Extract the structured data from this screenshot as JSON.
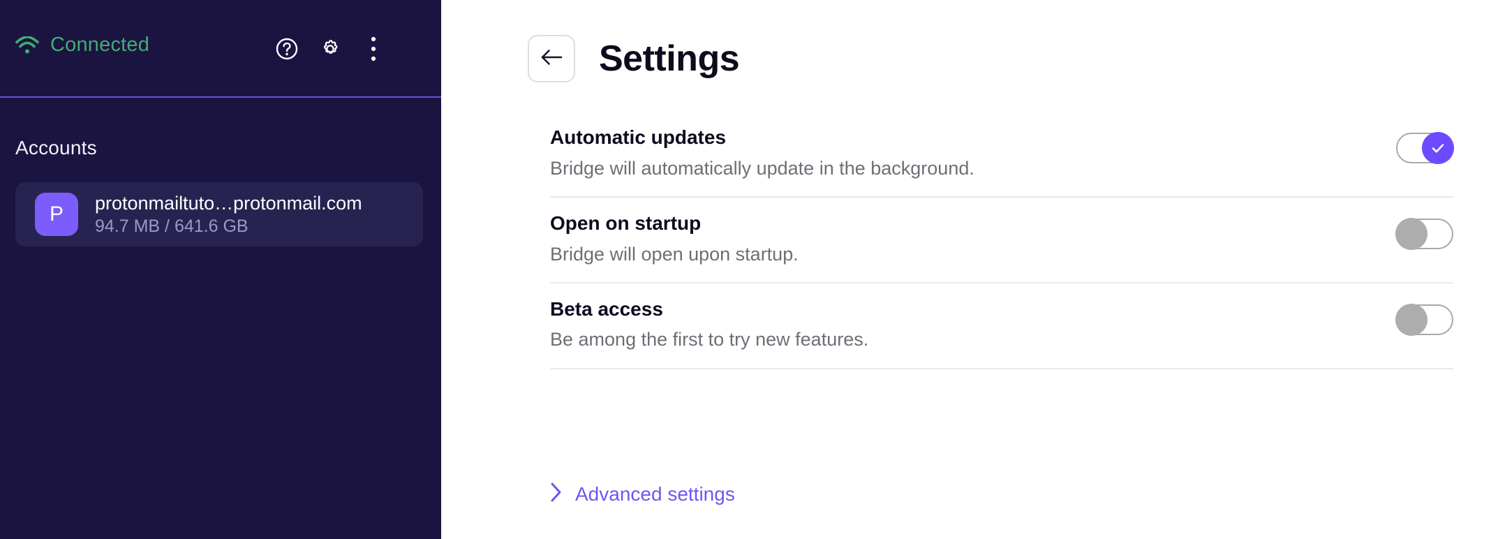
{
  "sidebar": {
    "status": {
      "icon": "wifi-icon",
      "label": "Connected",
      "color": "#3FAE73"
    },
    "header_icons": [
      {
        "name": "help-icon",
        "label": "?"
      },
      {
        "name": "gear-icon",
        "label": "settings"
      },
      {
        "name": "overflow-menu-icon",
        "label": "more"
      }
    ],
    "accounts_label": "Accounts",
    "accounts": [
      {
        "avatar_initial": "P",
        "avatar_color": "#7C5CFA",
        "email": "protonmailtuto…protonmail.com",
        "usage": "94.7 MB / 641.6 GB"
      }
    ]
  },
  "main": {
    "back_button_icon": "arrow-left-icon",
    "title": "Settings",
    "settings": [
      {
        "title": "Automatic updates",
        "description": "Bridge will automatically update in the background.",
        "toggle_state": "on"
      },
      {
        "title": "Open on startup",
        "description": "Bridge will open upon startup.",
        "toggle_state": "off"
      },
      {
        "title": "Beta access",
        "description": "Be among the first to try new features.",
        "toggle_state": "off"
      }
    ],
    "advanced": {
      "icon": "chevron-right-icon",
      "label": "Advanced settings",
      "color": "#7055F0"
    }
  },
  "annotation": {
    "color": "#E8412B",
    "target": "open-on-startup-toggle"
  }
}
